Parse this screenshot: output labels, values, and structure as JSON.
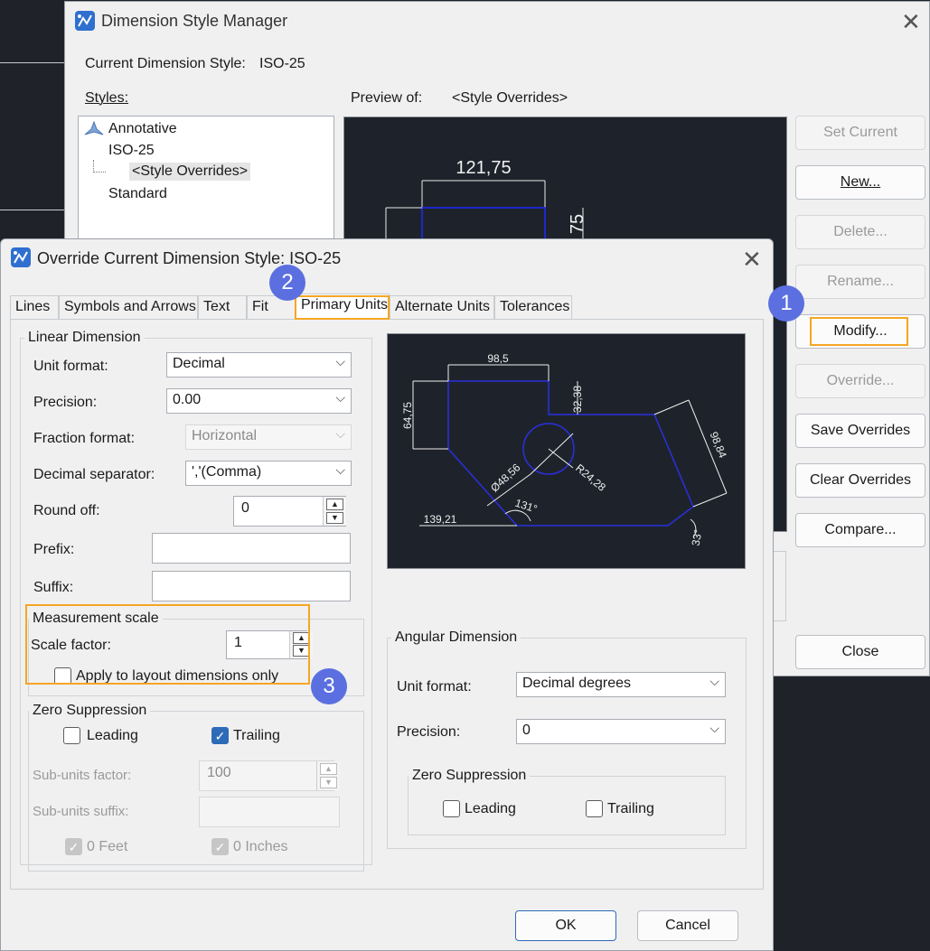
{
  "manager": {
    "title": "Dimension Style Manager",
    "current_label": "Current Dimension Style:",
    "current_value": "ISO-25",
    "styles_label": "Styles:",
    "preview_label": "Preview of:",
    "preview_value": "<Style Overrides>",
    "styles": [
      "Annotative",
      "ISO-25",
      "<Style Overrides>",
      "Standard"
    ],
    "preview_dims": {
      "top": "121,75",
      "side": "75"
    },
    "buttons": {
      "set_current": "Set Current",
      "new": "New...",
      "delete": "Delete...",
      "rename": "Rename...",
      "modify": "Modify...",
      "override": "Override...",
      "save_overrides": "Save Overrides",
      "clear_overrides": "Clear Overrides",
      "compare": "Compare...",
      "close": "Close"
    }
  },
  "override": {
    "title": "Override Current Dimension Style: ISO-25",
    "tabs": [
      "Lines",
      "Symbols and Arrows",
      "Text",
      "Fit",
      "Primary Units",
      "Alternate Units",
      "Tolerances"
    ],
    "active_tab": "Primary Units",
    "linear": {
      "title": "Linear Dimension",
      "unit_format_label": "Unit format:",
      "unit_format_value": "Decimal",
      "precision_label": "Precision:",
      "precision_value": "0.00",
      "fraction_label": "Fraction format:",
      "fraction_value": "Horizontal",
      "decimal_sep_label": "Decimal separator:",
      "decimal_sep_value": "','(Comma)",
      "round_off_label": "Round off:",
      "round_off_value": "0",
      "prefix_label": "Prefix:",
      "suffix_label": "Suffix:"
    },
    "measurement": {
      "title": "Measurement scale",
      "scale_label": "Scale factor:",
      "scale_value": "1",
      "apply_layout_label": "Apply to layout dimensions only",
      "apply_layout_checked": false
    },
    "zero_linear": {
      "title": "Zero Suppression",
      "leading_label": "Leading",
      "leading_checked": false,
      "trailing_label": "Trailing",
      "trailing_checked": true,
      "subunits_factor_label": "Sub-units factor:",
      "subunits_factor_value": "100",
      "subunits_suffix_label": "Sub-units suffix:",
      "feet_label": "0 Feet",
      "inches_label": "0 Inches"
    },
    "preview_dims": {
      "d1": "98,5",
      "d2": "32,38",
      "d3": "64,75",
      "d4": "98,84",
      "d5": "Ø48,56",
      "d6": "R24,28",
      "d7": "131°",
      "d8": "139,21",
      "d9": "33°"
    },
    "angular": {
      "title": "Angular Dimension",
      "unit_format_label": "Unit format:",
      "unit_format_value": "Decimal degrees",
      "precision_label": "Precision:",
      "precision_value": "0",
      "zero_title": "Zero Suppression",
      "leading_label": "Leading",
      "leading_checked": false,
      "trailing_label": "Trailing",
      "trailing_checked": false
    },
    "buttons": {
      "ok": "OK",
      "cancel": "Cancel"
    }
  },
  "callouts": [
    "1",
    "2",
    "3"
  ],
  "colors": {
    "highlight": "#f5a623",
    "badge": "#5b6fe0",
    "accent": "#2d6bb8",
    "drawing": "#1e232b"
  }
}
